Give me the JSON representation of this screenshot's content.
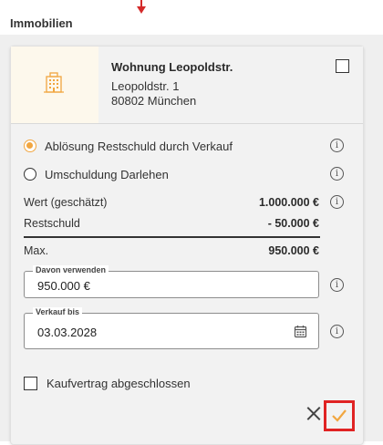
{
  "section": {
    "title": "Immobilien"
  },
  "property": {
    "name": "Wohnung Leopoldstr.",
    "street": "Leopoldstr. 1",
    "city": "80802 München",
    "selected": false,
    "icon": "building-icon"
  },
  "options": [
    {
      "label": "Ablösung Restschuld durch Verkauf",
      "selected": true
    },
    {
      "label": "Umschuldung Darlehen",
      "selected": false
    }
  ],
  "values": {
    "wert_label": "Wert (geschätzt)",
    "wert_value": "1.000.000 €",
    "restschuld_label": "Restschuld",
    "restschuld_value": "- 50.000 €",
    "max_label": "Max.",
    "max_value": "950.000 €"
  },
  "fields": {
    "davon_label": "Davon verwenden",
    "davon_value": "950.000 €",
    "verkauf_label": "Verkauf bis",
    "verkauf_value": "03.03.2028"
  },
  "kaufvertrag": {
    "label": "Kaufvertrag abgeschlossen",
    "checked": false
  },
  "colors": {
    "accent": "#f1a640",
    "highlight": "#e02323"
  }
}
